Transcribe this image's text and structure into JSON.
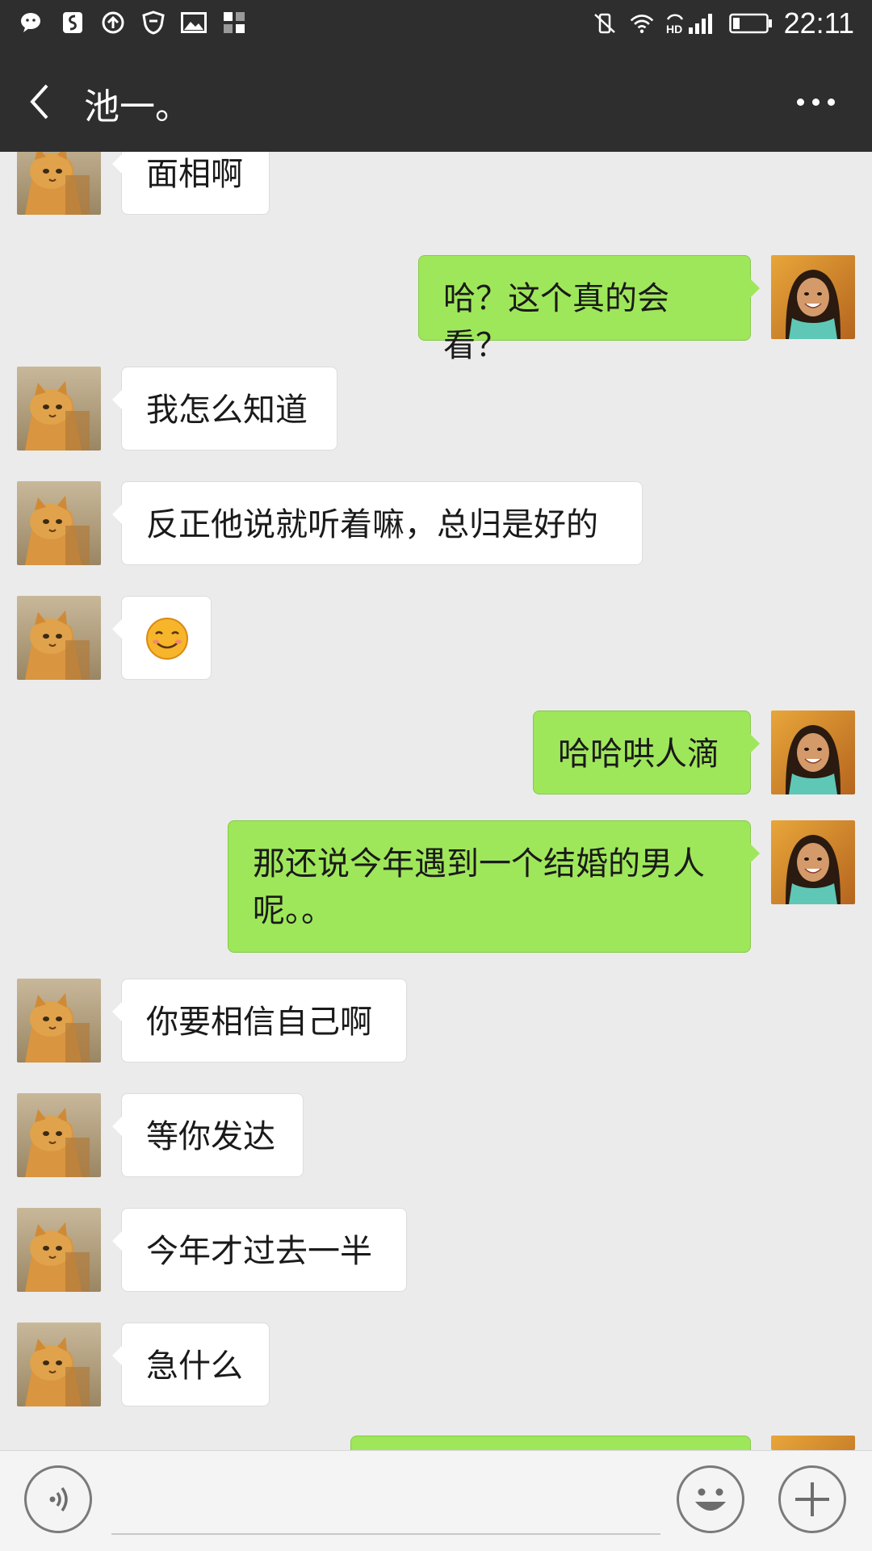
{
  "status_bar": {
    "time": "22:11",
    "left_icons": [
      "wechat-icon",
      "soul-icon",
      "sync-icon",
      "shield-icon",
      "image-icon",
      "apps-icon"
    ],
    "right_icons": [
      "vibrate-icon",
      "wifi-icon",
      "hd-signal-icon",
      "battery-icon"
    ]
  },
  "header": {
    "title": "池一。",
    "back_icon": "chevron-left-icon",
    "more_icon": "more-icon"
  },
  "messages": [
    {
      "from": "other",
      "text": "面相啊"
    },
    {
      "from": "me",
      "text": "哈？这个真的会看？"
    },
    {
      "from": "other",
      "text": "我怎么知道"
    },
    {
      "from": "other",
      "text": "反正他说就听着嘛，总归是好的"
    },
    {
      "from": "other",
      "emoji": "smile-emoji-icon"
    },
    {
      "from": "me",
      "text": "哈哈哄人滴"
    },
    {
      "from": "me",
      "text": "那还说今年遇到一个结婚的男人呢。。"
    },
    {
      "from": "other",
      "text": "你要相信自己啊"
    },
    {
      "from": "other",
      "text": "等你发达"
    },
    {
      "from": "other",
      "text": "今年才过去一半"
    },
    {
      "from": "other",
      "text": "急什么"
    }
  ],
  "input_bar": {
    "voice_icon": "voice-icon",
    "text_value": "",
    "emoji_icon": "emoji-icon",
    "plus_icon": "plus-icon"
  },
  "colors": {
    "bar_bg": "#2e2e2e",
    "chat_bg": "#ebebeb",
    "out_bubble": "#9fe75a",
    "in_bubble": "#ffffff"
  }
}
